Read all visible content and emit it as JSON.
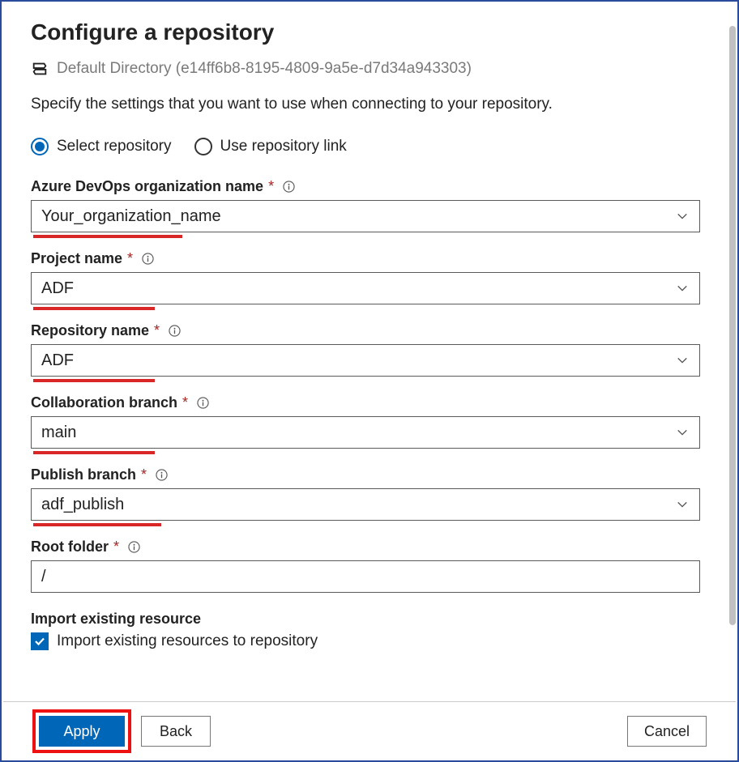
{
  "title": "Configure a repository",
  "breadcrumb": "Default Directory (e14ff6b8-8195-4809-9a5e-d7d34a943303)",
  "description": "Specify the settings that you want to use when connecting to your repository.",
  "radio": {
    "select_repo": "Select repository",
    "use_link": "Use repository link",
    "selected": "select_repo"
  },
  "fields": {
    "org": {
      "label": "Azure DevOps organization name",
      "value": "Your_organization_name"
    },
    "project": {
      "label": "Project name",
      "value": "ADF"
    },
    "repo": {
      "label": "Repository name",
      "value": "ADF"
    },
    "collab": {
      "label": "Collaboration branch",
      "value": "main"
    },
    "publish": {
      "label": "Publish branch",
      "value": "adf_publish"
    },
    "root": {
      "label": "Root folder",
      "value": "/"
    }
  },
  "import_section": {
    "heading": "Import existing resource",
    "checkbox_label": "Import existing resources to repository",
    "checked": true
  },
  "buttons": {
    "apply": "Apply",
    "back": "Back",
    "cancel": "Cancel"
  }
}
